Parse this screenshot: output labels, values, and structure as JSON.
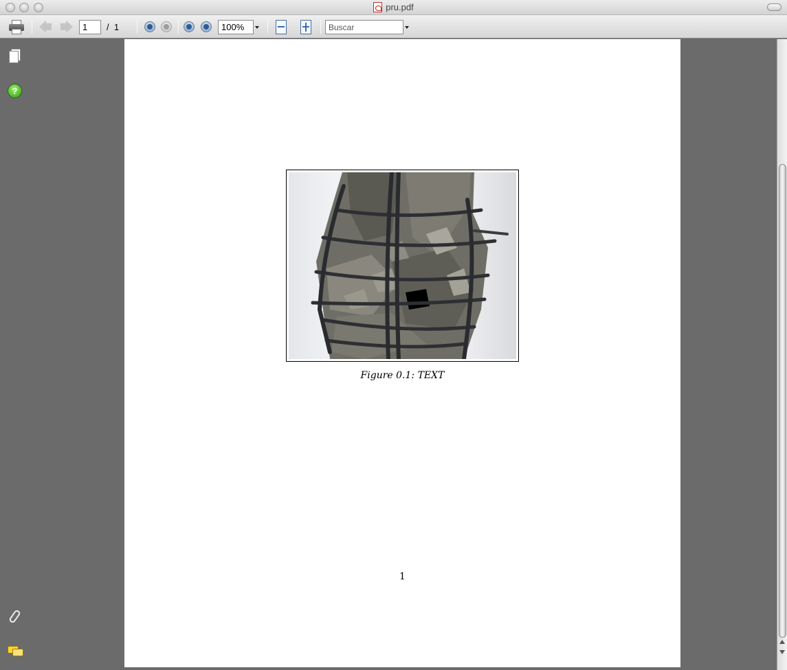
{
  "window": {
    "title": "pru.pdf"
  },
  "toolbar": {
    "page_current": "1",
    "page_separator": "/",
    "page_total": "1",
    "zoom": "100%",
    "search_placeholder": "Buscar"
  },
  "document": {
    "figure_caption": "Figure 0.1:  TEXT",
    "page_number": "1"
  },
  "icons": {
    "print": "printer-icon",
    "prev": "arrow-left-icon",
    "next": "arrow-right-icon",
    "help": "help-icon",
    "pages": "pages-icon",
    "attachments": "paperclip-icon",
    "comments": "comments-icon"
  }
}
